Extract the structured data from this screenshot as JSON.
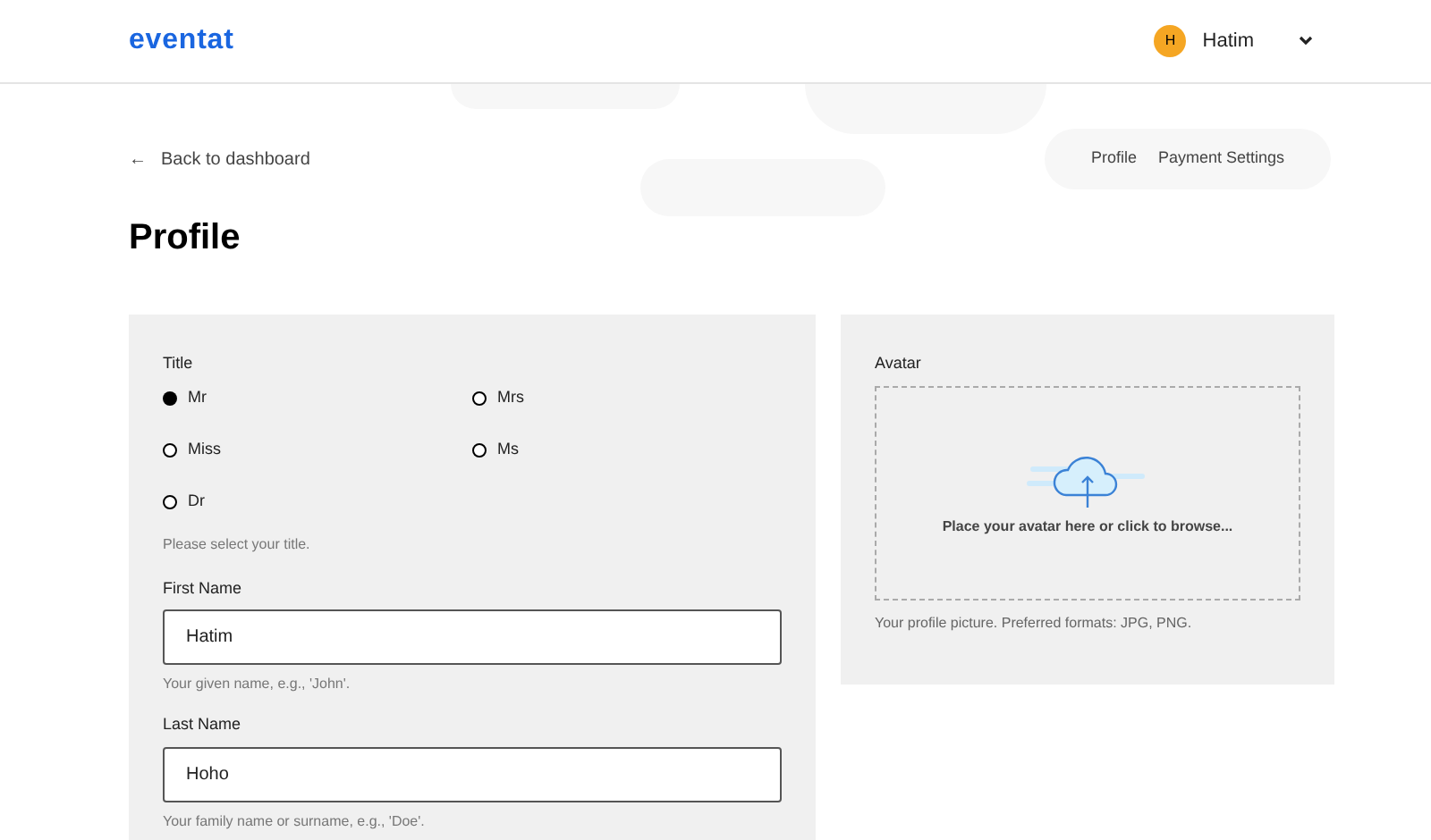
{
  "header": {
    "logo": "eventat",
    "user": {
      "initial": "H",
      "name": "Hatim"
    }
  },
  "back_link": {
    "arrow": "←",
    "label": "Back to dashboard"
  },
  "tabs": [
    {
      "label": "Profile",
      "selected": false
    },
    {
      "label": "Payment Settings",
      "selected": false
    }
  ],
  "page_title": "Profile",
  "form": {
    "title_group": {
      "label": "Title",
      "options": [
        {
          "label": "Mr",
          "selected": true
        },
        {
          "label": "Mrs",
          "selected": false
        },
        {
          "label": "Miss",
          "selected": false
        },
        {
          "label": "Ms",
          "selected": false
        },
        {
          "label": "Dr",
          "selected": false
        }
      ],
      "help": "Please select your title."
    },
    "fields": [
      {
        "label": "First Name",
        "value": "Hatim",
        "help": "Your given name, e.g., 'John'."
      },
      {
        "label": "Last Name",
        "value": "Hoho",
        "help": "Your family name or surname, e.g., 'Doe'."
      }
    ]
  },
  "avatar": {
    "label": "Avatar",
    "dropzone_text": "Place your avatar here or click to browse...",
    "help": "Your profile picture. Preferred formats: JPG, PNG."
  }
}
